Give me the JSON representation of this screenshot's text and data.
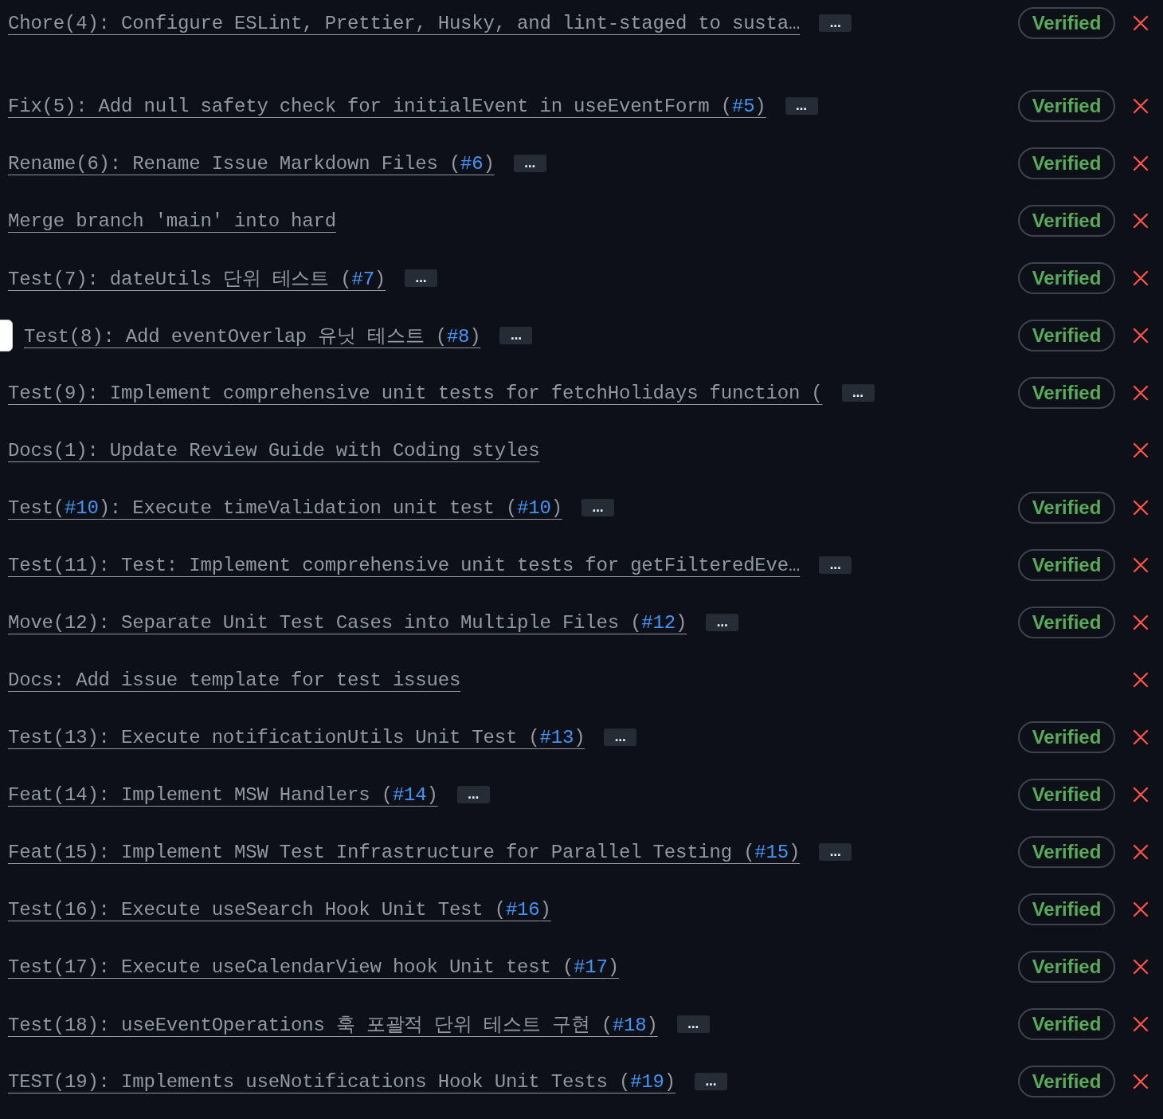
{
  "commits": [
    {
      "segments": [
        {
          "kind": "text",
          "text": "Chore(4): Configure ESLint, Prettier, Husky, and lint-staged to susta…"
        }
      ],
      "more": "…",
      "badge": "Verified",
      "failed": true,
      "focused": false
    },
    {
      "segments": [
        {
          "kind": "text",
          "text": "Fix(5): Add null safety check for initialEvent in useEventForm ("
        },
        {
          "kind": "link",
          "text": "#5"
        },
        {
          "kind": "text",
          "text": ")"
        }
      ],
      "more": "…",
      "badge": "Verified",
      "failed": true,
      "focused": false
    },
    {
      "segments": [
        {
          "kind": "text",
          "text": "Rename(6): Rename Issue Markdown Files ("
        },
        {
          "kind": "link",
          "text": "#6"
        },
        {
          "kind": "text",
          "text": ")"
        }
      ],
      "more": "…",
      "badge": "Verified",
      "failed": true,
      "focused": false
    },
    {
      "segments": [
        {
          "kind": "text",
          "text": "Merge branch 'main' into hard"
        }
      ],
      "badge": "Verified",
      "failed": true,
      "focused": false
    },
    {
      "segments": [
        {
          "kind": "text",
          "text": "Test(7): dateUtils 단위 테스트 ("
        },
        {
          "kind": "link",
          "text": "#7"
        },
        {
          "kind": "text",
          "text": ")"
        }
      ],
      "more": "…",
      "badge": "Verified",
      "failed": true,
      "focused": false
    },
    {
      "segments": [
        {
          "kind": "text",
          "text": "Test(8): Add eventOverlap 유닛 테스트 ("
        },
        {
          "kind": "link",
          "text": "#8"
        },
        {
          "kind": "text",
          "text": ")"
        }
      ],
      "more": "…",
      "badge": "Verified",
      "failed": true,
      "focused": true
    },
    {
      "segments": [
        {
          "kind": "text",
          "text": "Test(9): Implement comprehensive unit tests for fetchHolidays function ("
        }
      ],
      "more": "…",
      "badge": "Verified",
      "failed": true,
      "focused": false
    },
    {
      "segments": [
        {
          "kind": "text",
          "text": "Docs(1): Update Review Guide with Coding styles"
        }
      ],
      "failed": true,
      "focused": false
    },
    {
      "segments": [
        {
          "kind": "text",
          "text": "Test("
        },
        {
          "kind": "link",
          "text": "#10"
        },
        {
          "kind": "text",
          "text": "): Execute timeValidation unit test ("
        },
        {
          "kind": "link",
          "text": "#10"
        },
        {
          "kind": "text",
          "text": ")"
        }
      ],
      "more": "…",
      "badge": "Verified",
      "failed": true,
      "focused": false
    },
    {
      "segments": [
        {
          "kind": "text",
          "text": "Test(11): Test: Implement comprehensive unit tests for getFilteredEve…"
        }
      ],
      "more": "…",
      "badge": "Verified",
      "failed": true,
      "focused": false
    },
    {
      "segments": [
        {
          "kind": "text",
          "text": "Move(12): Separate Unit Test Cases into Multiple Files ("
        },
        {
          "kind": "link",
          "text": "#12"
        },
        {
          "kind": "text",
          "text": ")"
        }
      ],
      "more": "…",
      "badge": "Verified",
      "failed": true,
      "focused": false
    },
    {
      "segments": [
        {
          "kind": "text",
          "text": "Docs: Add issue template for test issues"
        }
      ],
      "failed": true,
      "focused": false
    },
    {
      "segments": [
        {
          "kind": "text",
          "text": "Test(13): Execute notificationUtils Unit Test ("
        },
        {
          "kind": "link",
          "text": "#13"
        },
        {
          "kind": "text",
          "text": ")"
        }
      ],
      "more": "…",
      "badge": "Verified",
      "failed": true,
      "focused": false
    },
    {
      "segments": [
        {
          "kind": "text",
          "text": "Feat(14): Implement MSW Handlers ("
        },
        {
          "kind": "link",
          "text": "#14"
        },
        {
          "kind": "text",
          "text": ")"
        }
      ],
      "more": "…",
      "badge": "Verified",
      "failed": true,
      "focused": false
    },
    {
      "segments": [
        {
          "kind": "text",
          "text": "Feat(15): Implement MSW Test Infrastructure for Parallel Testing ("
        },
        {
          "kind": "link",
          "text": "#15"
        },
        {
          "kind": "text",
          "text": ")"
        }
      ],
      "more": "…",
      "badge": "Verified",
      "failed": true,
      "focused": false
    },
    {
      "segments": [
        {
          "kind": "text",
          "text": "Test(16): Execute useSearch Hook Unit Test ("
        },
        {
          "kind": "link",
          "text": "#16"
        },
        {
          "kind": "text",
          "text": ")"
        }
      ],
      "badge": "Verified",
      "failed": true,
      "focused": false
    },
    {
      "segments": [
        {
          "kind": "text",
          "text": "Test(17): Execute useCalendarView hook Unit test ("
        },
        {
          "kind": "link",
          "text": "#17"
        },
        {
          "kind": "text",
          "text": ")"
        }
      ],
      "badge": "Verified",
      "failed": true,
      "focused": false
    },
    {
      "segments": [
        {
          "kind": "text",
          "text": "Test(18): useEventOperations 훅 포괄적 단위 테스트 구현 ("
        },
        {
          "kind": "link",
          "text": "#18"
        },
        {
          "kind": "text",
          "text": ")"
        }
      ],
      "more": "…",
      "badge": "Verified",
      "failed": true,
      "focused": false
    },
    {
      "segments": [
        {
          "kind": "text",
          "text": "TEST(19): Implements useNotifications Hook Unit Tests ("
        },
        {
          "kind": "link",
          "text": "#19"
        },
        {
          "kind": "text",
          "text": ")"
        }
      ],
      "more": "…",
      "badge": "Verified",
      "failed": true,
      "focused": false
    }
  ]
}
